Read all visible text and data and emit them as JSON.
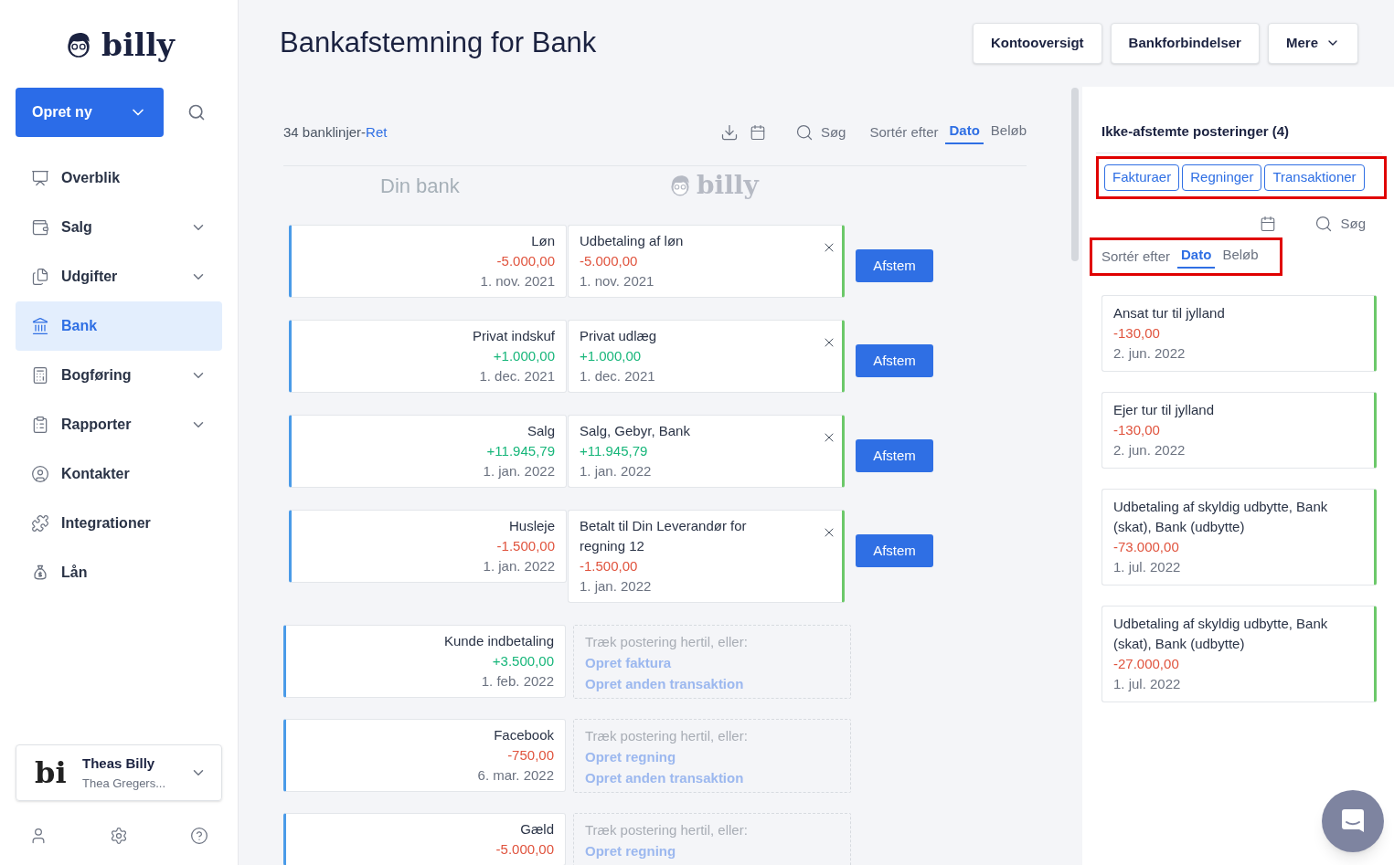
{
  "sidebar": {
    "logo": "billy",
    "create_button": "Opret ny",
    "items": [
      {
        "label": "Overblik",
        "selected": false,
        "expandable": false
      },
      {
        "label": "Salg",
        "selected": false,
        "expandable": true
      },
      {
        "label": "Udgifter",
        "selected": false,
        "expandable": true
      },
      {
        "label": "Bank",
        "selected": true,
        "expandable": false
      },
      {
        "label": "Bogføring",
        "selected": false,
        "expandable": true
      },
      {
        "label": "Rapporter",
        "selected": false,
        "expandable": true
      },
      {
        "label": "Kontakter",
        "selected": false,
        "expandable": false
      },
      {
        "label": "Integrationer",
        "selected": false,
        "expandable": false
      },
      {
        "label": "Lån",
        "selected": false,
        "expandable": false
      }
    ],
    "company": {
      "logo": "bi",
      "name": "Theas Billy",
      "user": "Thea Gregers..."
    }
  },
  "header": {
    "title": "Bankafstemning for Bank",
    "buttons": [
      {
        "label": "Kontooversigt",
        "dropdown": false
      },
      {
        "label": "Bankforbindelser",
        "dropdown": false
      },
      {
        "label": "Mere",
        "dropdown": true
      }
    ]
  },
  "toolbar": {
    "count": "34 banklinjer",
    "separator": "-",
    "edit_link": "Ret",
    "search": "Søg",
    "sort_label": "Sortér efter",
    "sort_options": [
      {
        "label": "Dato",
        "selected": true
      },
      {
        "label": "Beløb",
        "selected": false
      }
    ]
  },
  "columns": {
    "bank": "Din bank",
    "billy": "billy"
  },
  "matched": [
    {
      "bank": {
        "name": "Løn",
        "amount": "-5.000,00",
        "kind": "negative",
        "date": "1. nov. 2021"
      },
      "entry": {
        "description": "Udbetaling af løn",
        "amount": "-5.000,00",
        "kind": "negative",
        "date": "1. nov. 2021"
      },
      "action": "Afstem"
    },
    {
      "bank": {
        "name": "Privat indskuf",
        "amount": "+1.000,00",
        "kind": "positive",
        "date": "1. dec. 2021"
      },
      "entry": {
        "description": "Privat udlæg",
        "amount": "+1.000,00",
        "kind": "positive",
        "date": "1. dec. 2021"
      },
      "action": "Afstem"
    },
    {
      "bank": {
        "name": "Salg",
        "amount": "+11.945,79",
        "kind": "positive",
        "date": "1. jan. 2022"
      },
      "entry": {
        "description": "Salg, Gebyr, Bank",
        "amount": "+11.945,79",
        "kind": "positive",
        "date": "1. jan. 2022"
      },
      "action": "Afstem"
    },
    {
      "bank": {
        "name": "Husleje",
        "amount": "-1.500,00",
        "kind": "negative",
        "date": "1. jan. 2022"
      },
      "entry": {
        "description": "Betalt til Din Leverandør for regning 12",
        "amount": "-1.500,00",
        "kind": "negative",
        "date": "1. jan. 2022"
      },
      "action": "Afstem"
    }
  ],
  "unmatched": [
    {
      "bank": {
        "name": "Kunde indbetaling",
        "amount": "+3.500,00",
        "kind": "positive",
        "date": "1. feb. 2022"
      },
      "prompt": "Træk postering hertil, eller:",
      "links": [
        "Opret faktura",
        "Opret anden transaktion"
      ]
    },
    {
      "bank": {
        "name": "Facebook",
        "amount": "-750,00",
        "kind": "negative",
        "date": "6. mar. 2022"
      },
      "prompt": "Træk postering hertil, eller:",
      "links": [
        "Opret regning",
        "Opret anden transaktion"
      ]
    },
    {
      "bank": {
        "name": "Gæld",
        "amount": "-5.000,00",
        "kind": "negative"
      },
      "prompt": "Træk postering hertil, eller:",
      "links": [
        "Opret regning"
      ]
    }
  ],
  "right_panel": {
    "title": "Ikke-afstemte posteringer (4)",
    "filters": {
      "highlighted": true,
      "items": [
        "Fakturaer",
        "Regninger",
        "Transaktioner"
      ]
    },
    "search": "Søg",
    "sort": {
      "highlighted": true,
      "label": "Sortér efter",
      "options": [
        {
          "label": "Dato",
          "selected": true
        },
        {
          "label": "Beløb",
          "selected": false
        }
      ]
    },
    "entries": [
      {
        "description": "Ansat tur til jylland",
        "amount": "-130,00",
        "kind": "negative",
        "date": "2. jun. 2022"
      },
      {
        "description": "Ejer tur til jylland",
        "amount": "-130,00",
        "kind": "negative",
        "date": "2. jun. 2022"
      },
      {
        "description": "Udbetaling af skyldig udbytte, Bank (skat), Bank (udbytte)",
        "amount": "-73.000,00",
        "kind": "negative",
        "date": "1. jul. 2022"
      },
      {
        "description": "Udbetaling af skyldig udbytte, Bank (skat), Bank (udbytte)",
        "amount": "-27.000,00",
        "kind": "negative",
        "date": "1. jul. 2022"
      }
    ]
  }
}
